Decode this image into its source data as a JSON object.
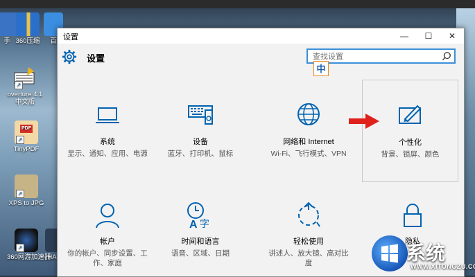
{
  "desktop": {
    "icons": [
      {
        "label": "手"
      },
      {
        "label": "360压缩"
      },
      {
        "label": "百"
      },
      {
        "label": "overture 4.1"
      },
      {
        "label": "中文版"
      },
      {
        "label": "TinyPDF"
      },
      {
        "label": "XPS to JPG"
      },
      {
        "label": "360网游加速器"
      },
      {
        "label": "HA"
      }
    ]
  },
  "window": {
    "title": "设置",
    "minimize": "—",
    "maximize": "☐",
    "close": "✕",
    "header_title": "设置",
    "search_placeholder": "查找设置",
    "ime_indicator": "中"
  },
  "tiles": [
    {
      "name": "系统",
      "desc": "显示、通知、应用、电源",
      "icon": "laptop-icon"
    },
    {
      "name": "设备",
      "desc": "蓝牙、打印机、鼠标",
      "icon": "devices-icon"
    },
    {
      "name": "网络和 Internet",
      "desc": "Wi-Fi、飞行模式、VPN",
      "icon": "globe-icon"
    },
    {
      "name": "个性化",
      "desc": "背景、锁屏、颜色",
      "icon": "personalization-icon"
    },
    {
      "name": "帐户",
      "desc": "你的帐户、同步设置、工作、家庭",
      "icon": "person-icon"
    },
    {
      "name": "时间和语言",
      "desc": "语音、区域、日期",
      "icon": "time-language-icon"
    },
    {
      "name": "轻松使用",
      "desc": "讲述人、放大镜、高对比度",
      "icon": "ease-of-access-icon"
    },
    {
      "name": "隐私",
      "desc": "",
      "icon": "lock-icon"
    }
  ],
  "watermark": {
    "brand": "系统",
    "url": "WWW.XITONGZU.COM"
  },
  "colors": {
    "accent": "#0063b1",
    "arrow": "#e0211b"
  }
}
